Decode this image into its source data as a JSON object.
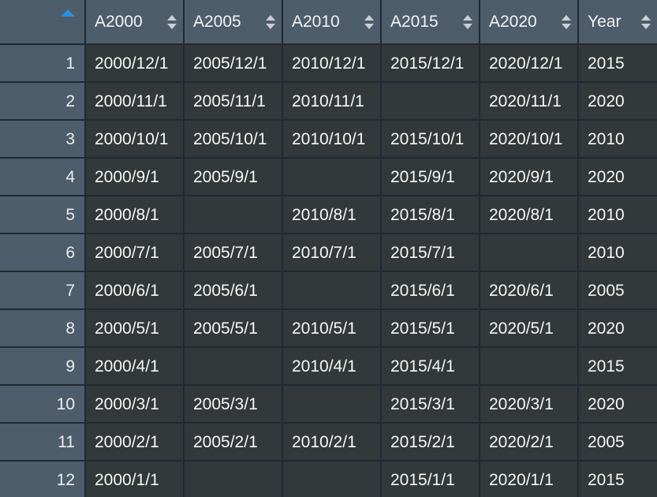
{
  "grid": {
    "sort": {
      "column": "rownum",
      "direction": "ascending",
      "indicator_icon": "triangle-up-icon",
      "indicator_color": "#2a8fe0"
    },
    "colors": {
      "header_background": "#4e5d6b",
      "rownumber_background": "#4e5d6b",
      "cell_background": "#33383b",
      "gridline": "#1f2a33",
      "text": "#f7f7f2",
      "page_background": "#2b3238"
    },
    "rownumber_header_label": "",
    "columns": [
      {
        "key": "A2000",
        "label": "A2000",
        "sortable": true,
        "sort_icon": "sort-updown-icon"
      },
      {
        "key": "A2005",
        "label": "A2005",
        "sortable": true,
        "sort_icon": "sort-updown-icon"
      },
      {
        "key": "A2010",
        "label": "A2010",
        "sortable": true,
        "sort_icon": "sort-updown-icon"
      },
      {
        "key": "A2015",
        "label": "A2015",
        "sortable": true,
        "sort_icon": "sort-updown-icon"
      },
      {
        "key": "A2020",
        "label": "A2020",
        "sortable": true,
        "sort_icon": "sort-updown-icon"
      },
      {
        "key": "Year",
        "label": "Year",
        "sortable": true,
        "sort_icon": "sort-updown-icon"
      }
    ],
    "rows": [
      {
        "n": "1",
        "A2000": "2000/12/1",
        "A2005": "2005/12/1",
        "A2010": "2010/12/1",
        "A2015": "2015/12/1",
        "A2020": "2020/12/1",
        "Year": "2015"
      },
      {
        "n": "2",
        "A2000": "2000/11/1",
        "A2005": "2005/11/1",
        "A2010": "2010/11/1",
        "A2015": "",
        "A2020": "2020/11/1",
        "Year": "2020"
      },
      {
        "n": "3",
        "A2000": "2000/10/1",
        "A2005": "2005/10/1",
        "A2010": "2010/10/1",
        "A2015": "2015/10/1",
        "A2020": "2020/10/1",
        "Year": "2010"
      },
      {
        "n": "4",
        "A2000": "2000/9/1",
        "A2005": "2005/9/1",
        "A2010": "",
        "A2015": "2015/9/1",
        "A2020": "2020/9/1",
        "Year": "2020"
      },
      {
        "n": "5",
        "A2000": "2000/8/1",
        "A2005": "",
        "A2010": "2010/8/1",
        "A2015": "2015/8/1",
        "A2020": "2020/8/1",
        "Year": "2010"
      },
      {
        "n": "6",
        "A2000": "2000/7/1",
        "A2005": "2005/7/1",
        "A2010": "2010/7/1",
        "A2015": "2015/7/1",
        "A2020": "",
        "Year": "2010"
      },
      {
        "n": "7",
        "A2000": "2000/6/1",
        "A2005": "2005/6/1",
        "A2010": "",
        "A2015": "2015/6/1",
        "A2020": "2020/6/1",
        "Year": "2005"
      },
      {
        "n": "8",
        "A2000": "2000/5/1",
        "A2005": "2005/5/1",
        "A2010": "2010/5/1",
        "A2015": "2015/5/1",
        "A2020": "2020/5/1",
        "Year": "2020"
      },
      {
        "n": "9",
        "A2000": "2000/4/1",
        "A2005": "",
        "A2010": "2010/4/1",
        "A2015": "2015/4/1",
        "A2020": "",
        "Year": "2015"
      },
      {
        "n": "10",
        "A2000": "2000/3/1",
        "A2005": "2005/3/1",
        "A2010": "",
        "A2015": "2015/3/1",
        "A2020": "2020/3/1",
        "Year": "2020"
      },
      {
        "n": "11",
        "A2000": "2000/2/1",
        "A2005": "2005/2/1",
        "A2010": "2010/2/1",
        "A2015": "2015/2/1",
        "A2020": "2020/2/1",
        "Year": "2005"
      },
      {
        "n": "12",
        "A2000": "2000/1/1",
        "A2005": "",
        "A2010": "",
        "A2015": "2015/1/1",
        "A2020": "2020/1/1",
        "Year": "2015"
      }
    ]
  }
}
